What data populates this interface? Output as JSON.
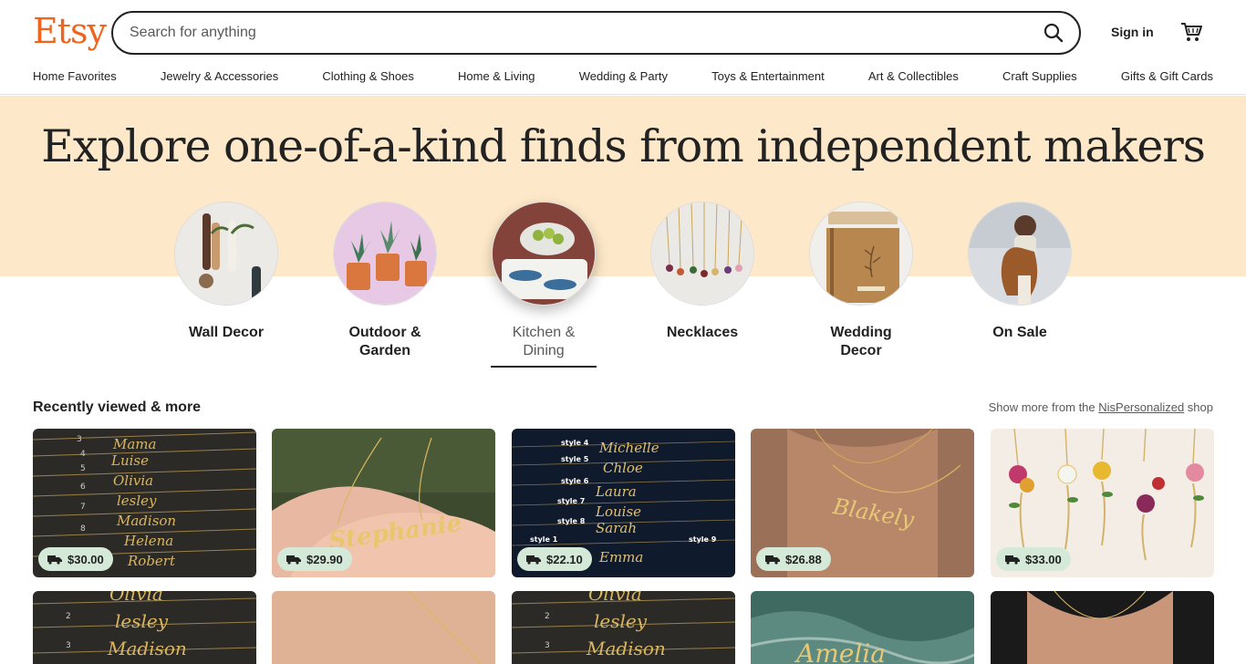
{
  "header": {
    "logo": "Etsy",
    "search_placeholder": "Search for anything",
    "sign_in": "Sign in",
    "nav": [
      "Home Favorites",
      "Jewelry & Accessories",
      "Clothing & Shoes",
      "Home & Living",
      "Wedding & Party",
      "Toys & Entertainment",
      "Art & Collectibles",
      "Craft Supplies",
      "Gifts & Gift Cards"
    ]
  },
  "hero": {
    "title": "Explore one-of-a-kind finds from independent makers",
    "categories": [
      {
        "line1": "Wall Decor",
        "line2": ""
      },
      {
        "line1": "Outdoor &",
        "line2": "Garden"
      },
      {
        "line1": "Kitchen &",
        "line2": "Dining"
      },
      {
        "line1": "Necklaces",
        "line2": ""
      },
      {
        "line1": "Wedding",
        "line2": "Decor"
      },
      {
        "line1": "On Sale",
        "line2": ""
      }
    ]
  },
  "recent": {
    "title": "Recently viewed & more",
    "more_prefix": "Show more from the ",
    "shop_name": "NisPersonalized",
    "more_suffix": " shop",
    "row1": [
      {
        "price": "$30.00"
      },
      {
        "price": "$29.90"
      },
      {
        "price": "$22.10"
      },
      {
        "price": "$26.88"
      },
      {
        "price": "$33.00"
      }
    ]
  },
  "colors": {
    "brand": "#f1641e",
    "hero_bg": "#fde9c9",
    "price_badge": "#d4e9d7"
  }
}
